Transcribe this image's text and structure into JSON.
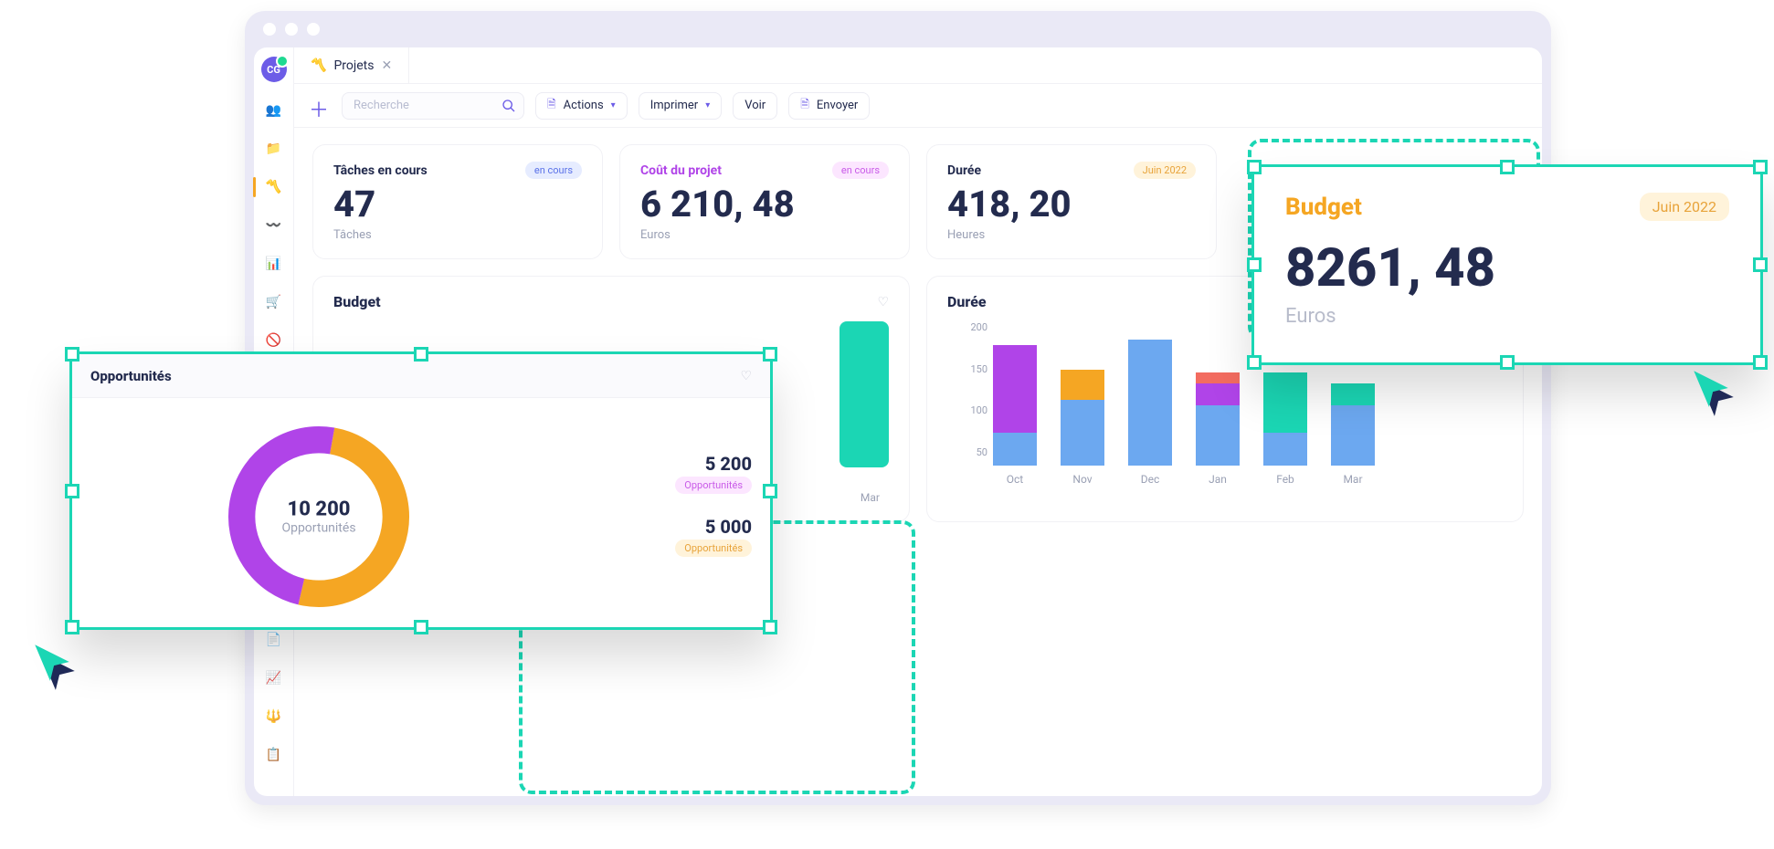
{
  "avatar_initials": "CG",
  "tab": {
    "label": "Projets",
    "icon": "trend-icon"
  },
  "toolbar": {
    "search_placeholder": "Recherche",
    "actions": "Actions",
    "print": "Imprimer",
    "view": "Voir",
    "send": "Envoyer"
  },
  "stats": {
    "tasks": {
      "title": "Tâches en cours",
      "badge": "en cours",
      "value": "47",
      "unit": "Tâches"
    },
    "cost": {
      "title": "Coût du projet",
      "badge": "en cours",
      "value": "6 210, 48",
      "unit": "Euros"
    },
    "duration": {
      "title": "Durée",
      "badge": "Juin 2022",
      "value": "418, 20",
      "unit": "Heures"
    }
  },
  "budget_panel": {
    "title": "Budget"
  },
  "duree_panel": {
    "title": "Durée"
  },
  "opportunities_panel": {
    "title": "Opportunités",
    "total_value": "10 200",
    "total_label": "Opportunités",
    "rows": [
      {
        "value": "5 200",
        "label": "Opportunités",
        "badge_class": "b-pink"
      },
      {
        "value": "5 000",
        "label": "Opportunités",
        "badge_class": "b-yellow"
      }
    ]
  },
  "float_budget": {
    "title": "Budget",
    "badge": "Juin 2022",
    "value": "8261, 48",
    "unit": "Euros"
  },
  "chart_data": {
    "type": "bar",
    "title": "Durée",
    "ylabel": "",
    "ylim": [
      0,
      250
    ],
    "yticks": [
      50,
      100,
      150,
      200
    ],
    "categories": [
      "Oct",
      "Nov",
      "Dec",
      "Jan",
      "Feb",
      "Mar"
    ],
    "series": [
      {
        "name": "seg1",
        "color": "#6CA8F0",
        "values": [
          60,
          120,
          230,
          110,
          60,
          110
        ]
      },
      {
        "name": "seg2",
        "color": "#B044E8",
        "values": [
          160,
          0,
          0,
          40,
          0,
          0
        ]
      },
      {
        "name": "seg3",
        "color": "#F5A623",
        "values": [
          0,
          55,
          0,
          0,
          0,
          0
        ]
      },
      {
        "name": "seg4",
        "color": "#F36C60",
        "values": [
          0,
          0,
          0,
          20,
          0,
          0
        ]
      },
      {
        "name": "seg5",
        "color": "#1BD6B4",
        "values": [
          0,
          0,
          0,
          0,
          110,
          40
        ]
      }
    ],
    "donut": {
      "total": 10200,
      "slices": [
        {
          "label": "Opportunités",
          "value": 5200,
          "color": "#F5A623"
        },
        {
          "label": "Opportunités",
          "value": 5000,
          "color": "#B044E8"
        }
      ]
    }
  },
  "side_icons": [
    "users-icon",
    "folder-icon",
    "trend-icon",
    "wave-icon",
    "bars-icon",
    "cart-icon",
    "block-icon",
    "wallet-icon",
    "heart-icon",
    "copy-icon",
    "chart-icon",
    "fork-icon",
    "list-icon"
  ]
}
